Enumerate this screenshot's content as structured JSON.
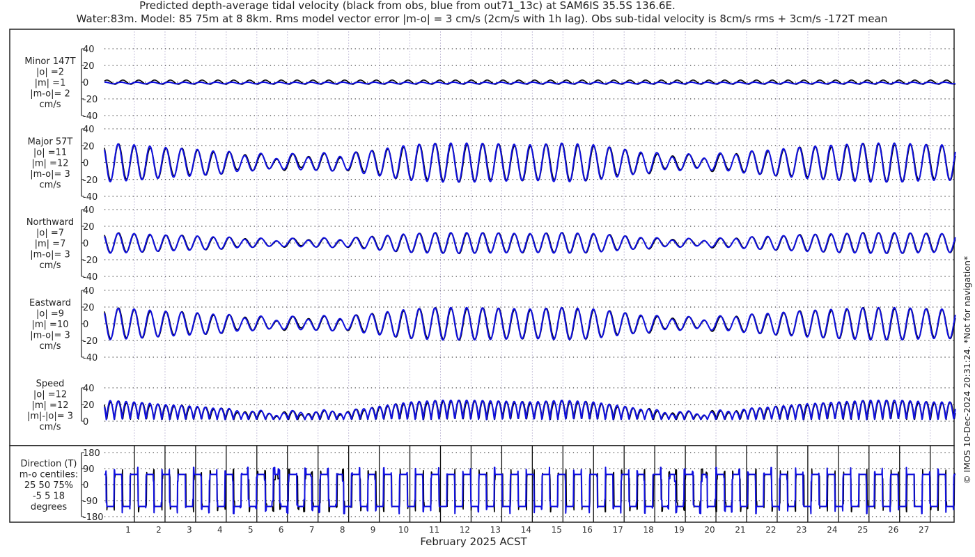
{
  "header": {
    "title_line1": "Predicted depth-average tidal velocity (black from obs, blue from out71_13c) at SAM6IS 35.5S 136.6E.",
    "title_line2": "Water:83m. Model: 85 75m at 8 8km. Rms model vector error |m-o| = 3 cm/s (2cm/s with 1h lag). Obs sub-tidal velocity is 8cm/s rms + 3cm/s -172T mean"
  },
  "footer": {
    "xlabel": "February 2025 ACST",
    "copyright": "© IMOS 10-Dec-2024 20:31:24. *Not for navigation*"
  },
  "colors": {
    "obs": "#000000",
    "model": "#1010e0",
    "grid": "#000000",
    "daygrid": "#c9c3dc"
  },
  "chart_data": {
    "type": "line",
    "xlabel": "February 2025 ACST",
    "x_ticks": [
      "1",
      "2",
      "3",
      "4",
      "5",
      "6",
      "7",
      "8",
      "9",
      "10",
      "11",
      "12",
      "13",
      "14",
      "15",
      "16",
      "17",
      "18",
      "19",
      "20",
      "21",
      "22",
      "23",
      "24",
      "25",
      "26",
      "27"
    ],
    "series_names": [
      "obs (black)",
      "model out71_13c (blue)"
    ],
    "semidiurnal_period_hours": 12.42,
    "major_daily_amplitude_cms": [
      22,
      20,
      17,
      15,
      12,
      8,
      7,
      9,
      9,
      15,
      20,
      22,
      22,
      21,
      20,
      22,
      20,
      15,
      10,
      7,
      8,
      12,
      15,
      18,
      20,
      22,
      22,
      20
    ],
    "panels": [
      {
        "key": "minor",
        "lines": [
          "Minor 147T",
          "|o| =2",
          "|m| =1",
          "|m-o|= 2",
          "cm/s"
        ],
        "ylim": [
          -40,
          40
        ],
        "ticks": [
          "40",
          "20",
          "0",
          "-20",
          "-40"
        ],
        "tickvals": [
          40,
          20,
          0,
          -20,
          -40
        ],
        "scale": 0.12,
        "model_scale": 0.06
      },
      {
        "key": "major",
        "lines": [
          "Major 57T",
          "|o| =11",
          "|m| =12",
          "|m-o|= 3",
          "cm/s"
        ],
        "ylim": [
          -40,
          40
        ],
        "ticks": [
          "40",
          "20",
          "0",
          "-20",
          "-40"
        ],
        "tickvals": [
          40,
          20,
          0,
          -20,
          -40
        ],
        "scale": 1.0,
        "model_scale": 1.05
      },
      {
        "key": "northward",
        "lines": [
          "Northward",
          "|o| =7",
          "|m| =7",
          "|m-o|= 3",
          "cm/s"
        ],
        "ylim": [
          -40,
          40
        ],
        "ticks": [
          "40",
          "20",
          "0",
          "-20",
          "-40"
        ],
        "tickvals": [
          40,
          20,
          0,
          -20,
          -40
        ],
        "scale": 0.55,
        "model_scale": 0.56
      },
      {
        "key": "eastward",
        "lines": [
          "Eastward",
          "|o| =9",
          "|m| =10",
          "|m-o|= 3",
          "cm/s"
        ],
        "ylim": [
          -40,
          40
        ],
        "ticks": [
          "40",
          "20",
          "0",
          "-20",
          "-40"
        ],
        "tickvals": [
          40,
          20,
          0,
          -20,
          -40
        ],
        "scale": 0.85,
        "model_scale": 0.88
      },
      {
        "key": "speed",
        "lines": [
          "Speed",
          "|o| =12",
          "|m| =12",
          "|m|-|o|= 3",
          "cm/s"
        ],
        "ylim": [
          0,
          40
        ],
        "ticks": [
          "40",
          "20",
          "0"
        ],
        "tickvals": [
          40,
          20,
          0
        ],
        "scale": 1.0,
        "model_scale": 1.05
      },
      {
        "key": "direction",
        "lines": [
          "Direction (T)",
          "m-o centiles:",
          "25  50  75%",
          "-5   5  18",
          "degrees"
        ],
        "ylim": [
          -180,
          180
        ],
        "ticks": [
          "180",
          "90",
          "0",
          "-90",
          "-180"
        ],
        "tickvals": [
          180,
          90,
          0,
          -90,
          -180
        ],
        "scale": 1.0,
        "model_scale": 1.0,
        "major_dir": 57
      }
    ]
  }
}
